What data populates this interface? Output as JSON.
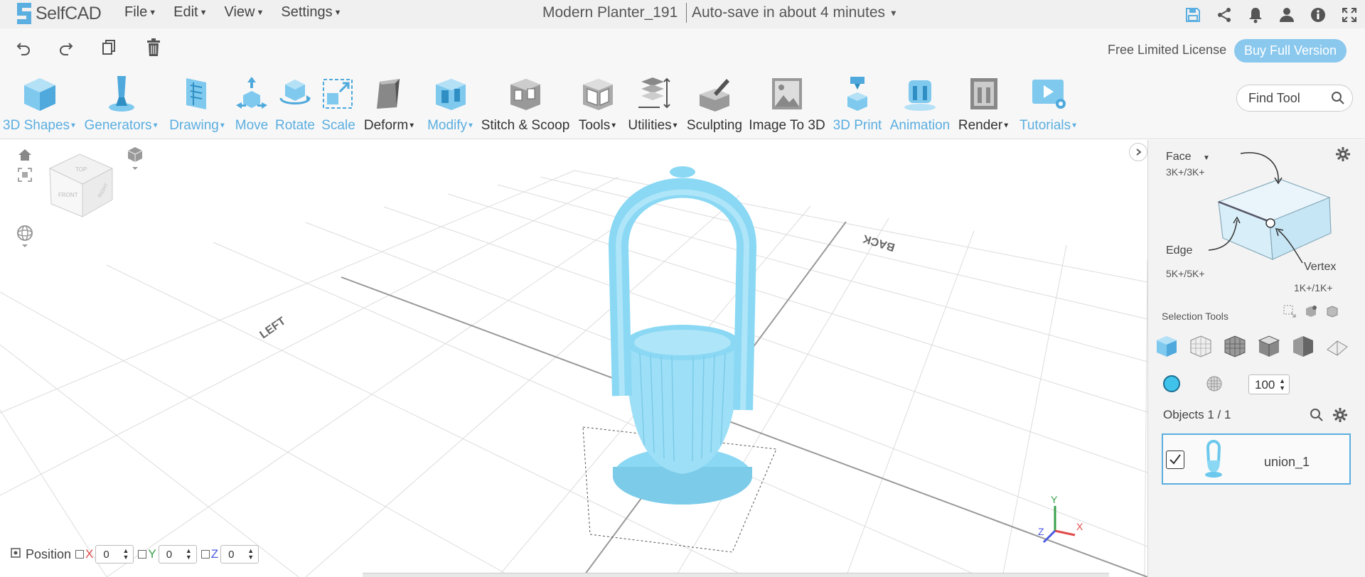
{
  "app": {
    "logo_text": "SelfCAD",
    "colors": {
      "accent": "#5aaee0",
      "model": "#8ad8f4",
      "buy_button": "#8ac8ee"
    }
  },
  "menu": [
    {
      "label": "File"
    },
    {
      "label": "Edit"
    },
    {
      "label": "View"
    },
    {
      "label": "Settings"
    }
  ],
  "document": {
    "title": "Modern Planter_191",
    "autosave": "Auto-save in about 4 minutes"
  },
  "top_icons": [
    "save-icon",
    "share-icon",
    "bell-icon",
    "user-icon",
    "info-icon",
    "fullscreen-icon"
  ],
  "license": {
    "text": "Free Limited License",
    "buy_label": "Buy Full Version"
  },
  "toolbar": {
    "tools": [
      {
        "label": "3D Shapes",
        "dropdown": true,
        "style": "blue"
      },
      {
        "label": "Generators",
        "dropdown": true,
        "style": "blue"
      },
      {
        "label": "Drawing",
        "dropdown": true,
        "style": "blue"
      },
      {
        "label": "Move",
        "dropdown": false,
        "style": "blue"
      },
      {
        "label": "Rotate",
        "dropdown": false,
        "style": "blue"
      },
      {
        "label": "Scale",
        "dropdown": false,
        "style": "blue"
      },
      {
        "label": "Deform",
        "dropdown": true,
        "style": "dark"
      },
      {
        "label": "Modify",
        "dropdown": true,
        "style": "blue"
      },
      {
        "label": "Stitch & Scoop",
        "dropdown": false,
        "style": "dark"
      },
      {
        "label": "Tools",
        "dropdown": true,
        "style": "dark"
      },
      {
        "label": "Utilities",
        "dropdown": true,
        "style": "dark"
      },
      {
        "label": "Sculpting",
        "dropdown": false,
        "style": "dark"
      },
      {
        "label": "Image To 3D",
        "dropdown": false,
        "style": "dark"
      },
      {
        "label": "3D Print",
        "dropdown": false,
        "style": "blue"
      },
      {
        "label": "Animation",
        "dropdown": false,
        "style": "blue"
      },
      {
        "label": "Render",
        "dropdown": true,
        "style": "dark"
      },
      {
        "label": "Tutorials",
        "dropdown": true,
        "style": "blue"
      }
    ],
    "find_placeholder": "Find Tool"
  },
  "viewport": {
    "cube_labels": {
      "top": "TOP",
      "front": "FRONT",
      "right": "RIGHT"
    },
    "grid_labels": {
      "left": "LEFT",
      "back": "BACK"
    },
    "axes": {
      "x": "X",
      "y": "Y",
      "z": "Z"
    }
  },
  "panel": {
    "face_label": "Face",
    "face_count": "3K+/3K+",
    "edge_label": "Edge",
    "edge_count": "5K+/5K+",
    "vertex_label": "Vertex",
    "vertex_count": "1K+/1K+",
    "selection_tools_label": "Selection Tools",
    "opacity_value": "100",
    "objects_label": "Objects 1 / 1",
    "object_name": "union_1"
  },
  "position": {
    "label": "Position",
    "x": "0",
    "y": "0",
    "z": "0"
  }
}
